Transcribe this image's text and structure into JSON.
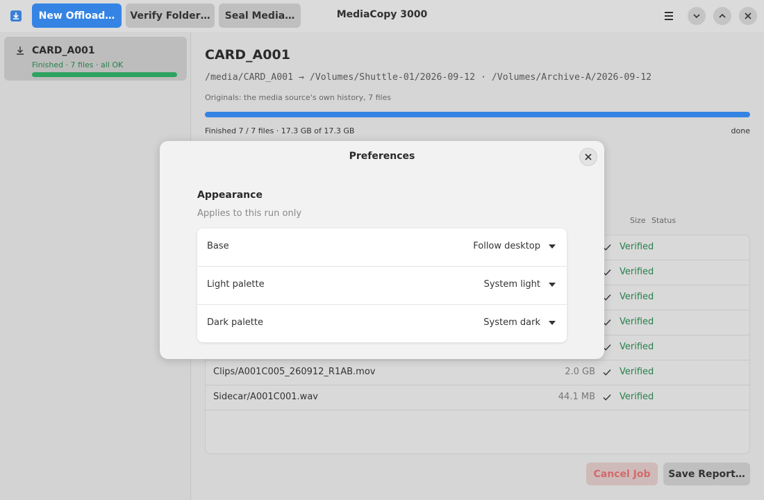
{
  "header": {
    "new_offload": "New Offload…",
    "verify_folder": "Verify Folder…",
    "seal_media": "Seal Media…",
    "title": "MediaCopy 3000"
  },
  "sidebar": {
    "items": [
      {
        "name": "CARD_A001",
        "status": "Finished · 7 files · all OK",
        "progress": 1.0
      }
    ]
  },
  "main": {
    "title": "CARD_A001",
    "paths": "/media/CARD_A001 → /Volumes/Shuttle-01/2026-09-12 · /Volumes/Archive-A/2026-09-12",
    "originals": "Originals: the media source's own history, 7 files",
    "progress": 1.0,
    "progress_text": "Finished 7 / 7 files · 17.3 GB of 17.3 GB",
    "progress_state": "done",
    "columns": {
      "size": "Size",
      "status": "Status"
    },
    "files": [
      {
        "name": "",
        "size": "",
        "status": "Verified"
      },
      {
        "name": "",
        "size": "",
        "status": "Verified"
      },
      {
        "name": "",
        "size": "",
        "status": "Verified"
      },
      {
        "name": "",
        "size": "",
        "status": "Verified"
      },
      {
        "name": "",
        "size": "",
        "status": "Verified"
      },
      {
        "name": "Clips/A001C005_260912_R1AB.mov",
        "size": "2.0 GB",
        "status": "Verified"
      },
      {
        "name": "Sidecar/A001C001.wav",
        "size": "44.1 MB",
        "status": "Verified"
      }
    ],
    "cancel": "Cancel Job",
    "save_report": "Save Report…"
  },
  "dialog": {
    "title": "Preferences",
    "section_title": "Appearance",
    "section_subtitle": "Applies to this run only",
    "rows": [
      {
        "label": "Base",
        "value": "Follow desktop"
      },
      {
        "label": "Light palette",
        "value": "System light"
      },
      {
        "label": "Dark palette",
        "value": "System dark"
      }
    ]
  },
  "colors": {
    "accent": "#3584e4",
    "success": "#26804a",
    "destructive": "#d26a6a"
  }
}
